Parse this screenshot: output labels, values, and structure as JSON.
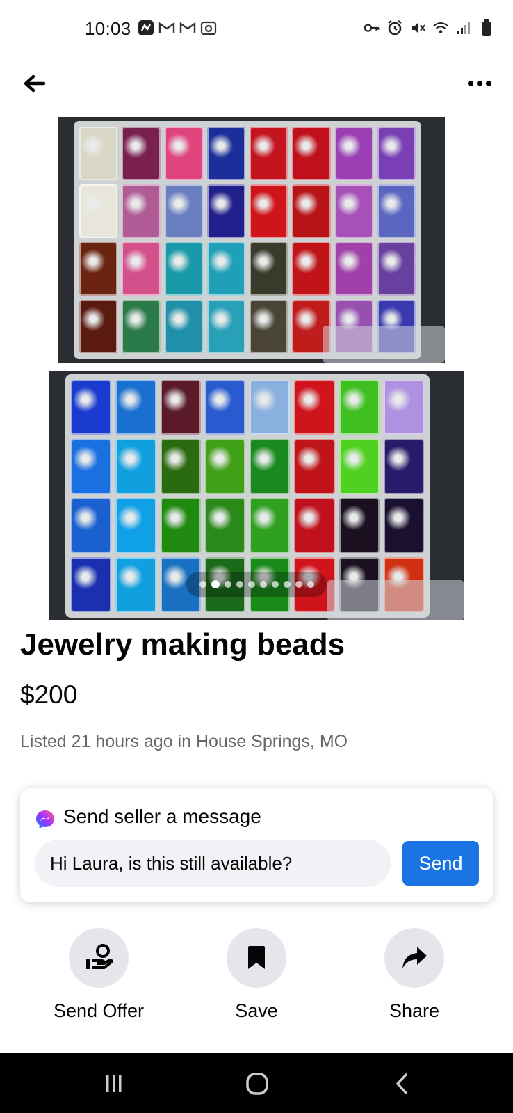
{
  "status_bar": {
    "time": "10:03",
    "left_icons": [
      "app-notification-icon",
      "gmail-icon",
      "gmail-icon",
      "camera-app-icon"
    ],
    "right_icons": [
      "vpn-key-icon",
      "alarm-icon",
      "mute-icon",
      "wifi-icon",
      "signal-icon",
      "battery-icon"
    ]
  },
  "nav": {
    "back_icon": "arrow-left-icon",
    "more_icon": "more-horizontal-icon"
  },
  "photos": {
    "count": 2,
    "page_indicator": {
      "total_dots": 10,
      "active_index": 1
    }
  },
  "listing": {
    "title": "Jewelry making beads",
    "price": "$200",
    "meta": "Listed 21 hours ago in House Springs, MO"
  },
  "message_card": {
    "heading": "Send seller a message",
    "input_value": "Hi Laura, is this still available?",
    "send_label": "Send"
  },
  "actions": [
    {
      "label": "Send Offer",
      "icon": "offer-hand-icon"
    },
    {
      "label": "Save",
      "icon": "bookmark-icon"
    },
    {
      "label": "Share",
      "icon": "share-arrow-icon"
    }
  ],
  "android_nav": [
    "recent-apps-icon",
    "home-icon",
    "back-chevron-icon"
  ],
  "colors": {
    "accent": "#1b74e4",
    "text_primary": "#050505",
    "text_secondary": "#65676b",
    "button_bg": "#e4e6eb",
    "input_bg": "#f0f2f5"
  }
}
